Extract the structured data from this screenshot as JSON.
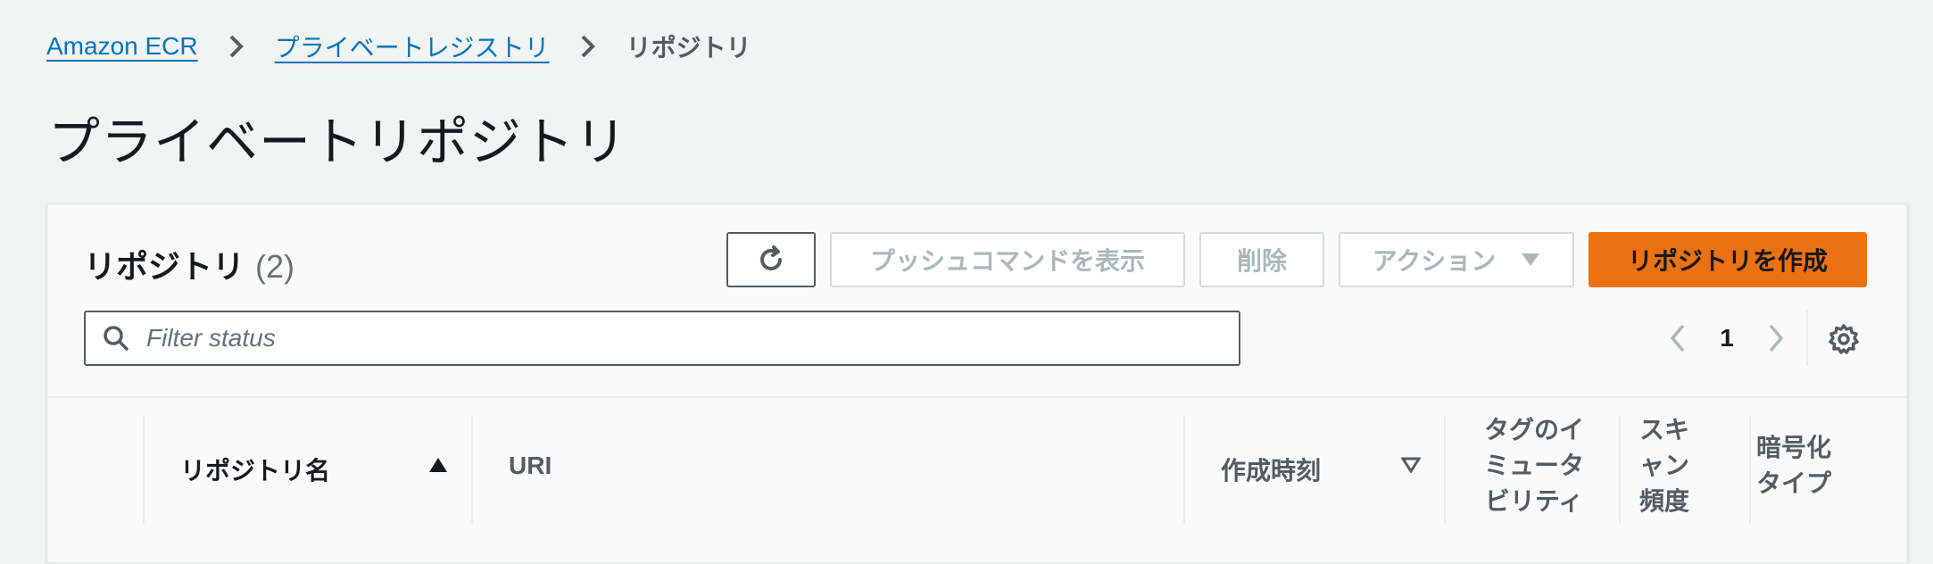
{
  "breadcrumb": {
    "items": [
      "Amazon ECR",
      "プライベートレジストリ"
    ],
    "current": "リポジトリ"
  },
  "page": {
    "title": "プライベートリポジトリ"
  },
  "panel": {
    "title": "リポジトリ",
    "count": "(2)",
    "buttons": {
      "push_commands": "プッシュコマンドを表示",
      "delete": "削除",
      "actions": "アクション",
      "create": "リポジトリを作成"
    },
    "search": {
      "placeholder": "Filter status",
      "value": ""
    },
    "pagination": {
      "current_page": "1"
    }
  },
  "table": {
    "columns": {
      "name": "リポジトリ名",
      "uri": "URI",
      "created": "作成時刻",
      "tag_immutability": [
        "タグのイ",
        "ミュータ",
        "ビリティ"
      ],
      "scan_frequency": [
        "スキ",
        "ャン",
        "頻度"
      ],
      "encryption_type": [
        "暗号化",
        "タイプ"
      ]
    }
  },
  "icons": {
    "breadcrumb_separator": "chevron-right-icon",
    "refresh": "refresh-icon",
    "search": "search-icon",
    "pagination_prev": "chevron-left-icon",
    "pagination_next": "chevron-right-icon",
    "settings": "gear-icon",
    "sort_ascending": "sort-ascending-icon",
    "sort_descending": "sort-descending-icon"
  },
  "colors": {
    "link": "#0073bb",
    "primary_button": "#ec7211",
    "background": "#f2f3f3",
    "disabled_text": "#aab7b8"
  }
}
